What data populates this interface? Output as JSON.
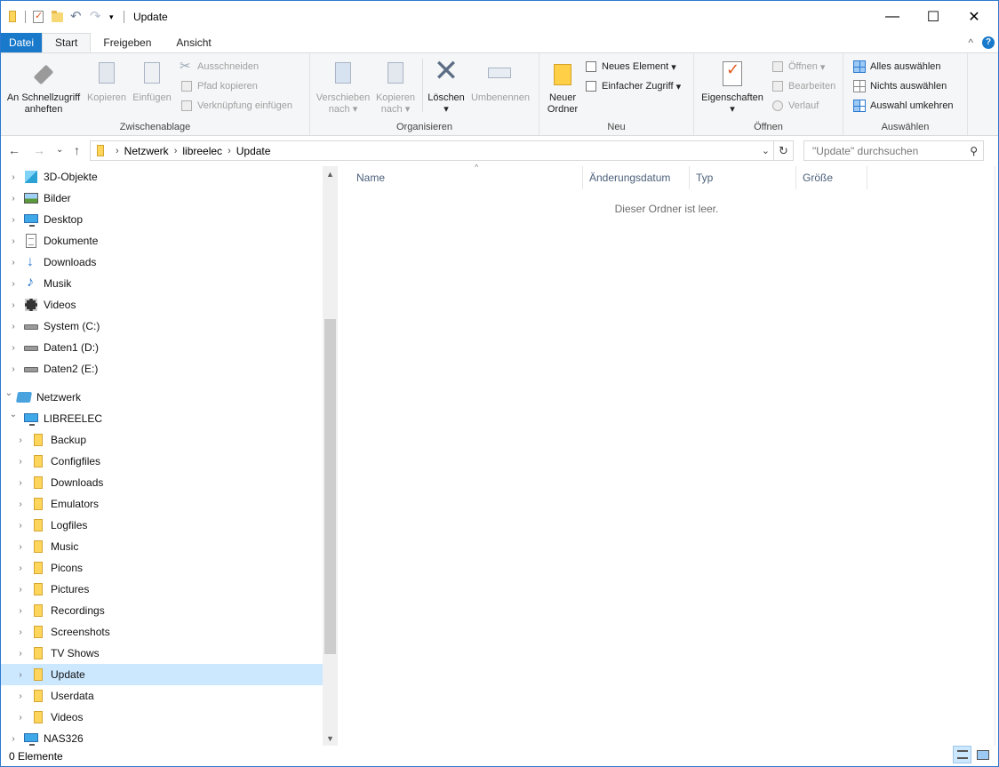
{
  "window": {
    "title": "Update",
    "minimize": "—",
    "maximize": "☐",
    "close": "✕"
  },
  "tabs": {
    "file": "Datei",
    "start": "Start",
    "share": "Freigeben",
    "view": "Ansicht",
    "collapse": "^",
    "help": "?"
  },
  "ribbon": {
    "clipboard": {
      "label": "Zwischenablage",
      "pin_line1": "An Schnellzugriff",
      "pin_line2": "anheften",
      "copy": "Kopieren",
      "paste": "Einfügen",
      "cut": "Ausschneiden",
      "copy_path": "Pfad kopieren",
      "paste_shortcut": "Verknüpfung einfügen"
    },
    "organize": {
      "label": "Organisieren",
      "move_line1": "Verschieben",
      "move_line2": "nach",
      "copyto_line1": "Kopieren",
      "copyto_line2": "nach",
      "delete": "Löschen",
      "rename": "Umbenennen"
    },
    "new": {
      "label": "Neu",
      "new_folder_line1": "Neuer",
      "new_folder_line2": "Ordner",
      "new_item": "Neues Element",
      "easy_access": "Einfacher Zugriff"
    },
    "open": {
      "label": "Öffnen",
      "properties": "Eigenschaften",
      "open": "Öffnen",
      "edit": "Bearbeiten",
      "history": "Verlauf"
    },
    "select": {
      "label": "Auswählen",
      "select_all": "Alles auswählen",
      "select_none": "Nichts auswählen",
      "invert": "Auswahl umkehren"
    }
  },
  "address": {
    "breadcrumb": [
      "Netzwerk",
      "libreelec",
      "Update"
    ],
    "search_placeholder": "\"Update\" durchsuchen"
  },
  "nav_tree": [
    {
      "label": "3D-Objekte",
      "icon": "cube-icon",
      "level": 0
    },
    {
      "label": "Bilder",
      "icon": "pictures-icon",
      "level": 0
    },
    {
      "label": "Desktop",
      "icon": "desktop-icon",
      "level": 0
    },
    {
      "label": "Dokumente",
      "icon": "document-icon",
      "level": 0
    },
    {
      "label": "Downloads",
      "icon": "download-icon",
      "level": 0
    },
    {
      "label": "Musik",
      "icon": "music-icon",
      "level": 0
    },
    {
      "label": "Videos",
      "icon": "video-icon",
      "level": 0
    },
    {
      "label": "System (C:)",
      "icon": "drive-icon",
      "level": 0
    },
    {
      "label": "Daten1 (D:)",
      "icon": "drive-icon",
      "level": 0
    },
    {
      "label": "Daten2 (E:)",
      "icon": "drive-icon",
      "level": 0
    },
    {
      "label": "Netzwerk",
      "icon": "network-icon",
      "level": -1
    },
    {
      "label": "LIBREELEC",
      "icon": "computer-icon",
      "level": 0
    },
    {
      "label": "Backup",
      "icon": "folder-icon",
      "level": 1
    },
    {
      "label": "Configfiles",
      "icon": "folder-icon",
      "level": 1
    },
    {
      "label": "Downloads",
      "icon": "folder-icon",
      "level": 1
    },
    {
      "label": "Emulators",
      "icon": "folder-icon",
      "level": 1
    },
    {
      "label": "Logfiles",
      "icon": "folder-icon",
      "level": 1
    },
    {
      "label": "Music",
      "icon": "folder-icon",
      "level": 1
    },
    {
      "label": "Picons",
      "icon": "folder-icon",
      "level": 1
    },
    {
      "label": "Pictures",
      "icon": "folder-icon",
      "level": 1
    },
    {
      "label": "Recordings",
      "icon": "folder-icon",
      "level": 1
    },
    {
      "label": "Screenshots",
      "icon": "folder-icon",
      "level": 1
    },
    {
      "label": "TV Shows",
      "icon": "folder-icon",
      "level": 1
    },
    {
      "label": "Update",
      "icon": "folder-icon",
      "level": 1,
      "selected": true
    },
    {
      "label": "Userdata",
      "icon": "folder-icon",
      "level": 1
    },
    {
      "label": "Videos",
      "icon": "folder-icon",
      "level": 1
    },
    {
      "label": "NAS326",
      "icon": "computer-icon",
      "level": 0
    }
  ],
  "columns": [
    "Name",
    "Änderungsdatum",
    "Typ",
    "Größe"
  ],
  "empty_message": "Dieser Ordner ist leer.",
  "status": "0 Elemente",
  "colors": {
    "accent": "#1979ca",
    "selection": "#cce8ff"
  }
}
